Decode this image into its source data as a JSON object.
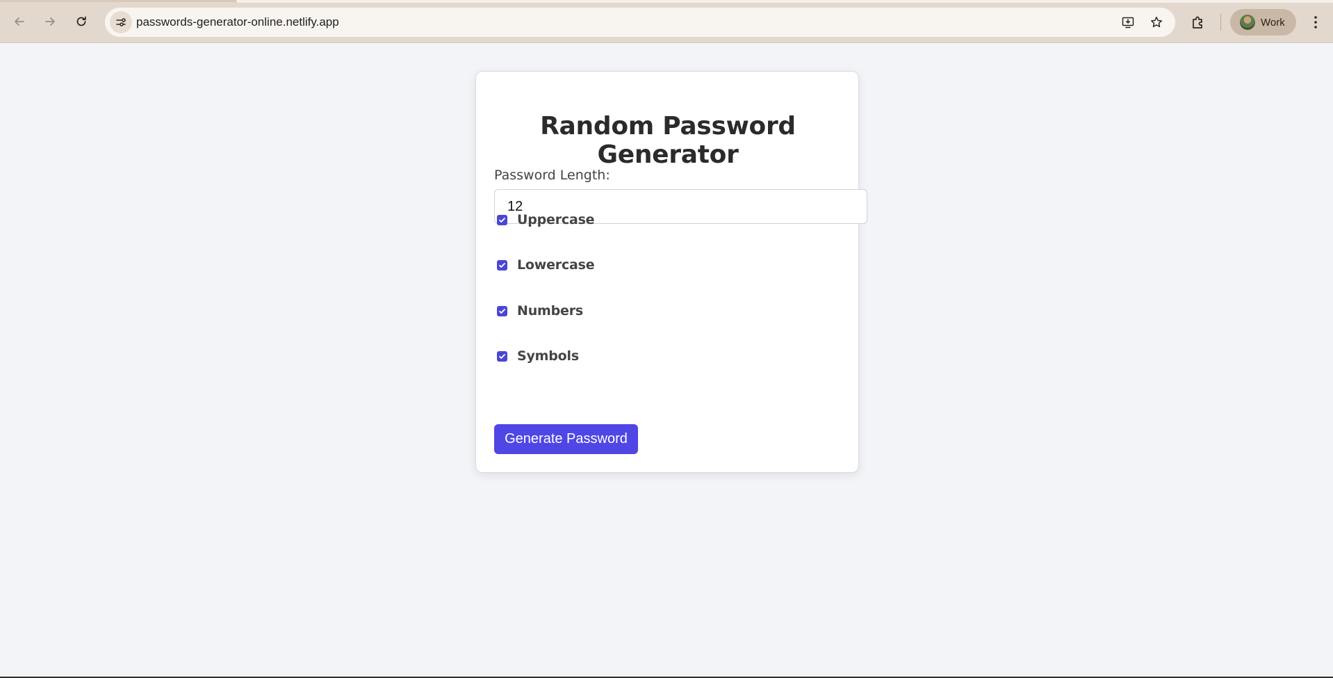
{
  "browser": {
    "url": "passwords-generator-online.netlify.app",
    "profile_name": "Work",
    "icons": [
      "back-icon",
      "forward-icon",
      "reload-icon",
      "site-info-icon",
      "install-app-icon",
      "bookmark-star-icon",
      "extensions-icon",
      "more-menu-icon"
    ]
  },
  "app": {
    "title": "Random Password Generator",
    "length_label": "Password Length:",
    "length_value": "12",
    "options": [
      {
        "label": "Uppercase",
        "checked": true
      },
      {
        "label": "Lowercase",
        "checked": true
      },
      {
        "label": "Numbers",
        "checked": true
      },
      {
        "label": "Symbols",
        "checked": true
      }
    ],
    "generate_label": "Generate Password"
  },
  "colors": {
    "accent": "#4f46e5",
    "page_background": "#f3f4f8",
    "chrome_background": "#e3d8cd"
  }
}
